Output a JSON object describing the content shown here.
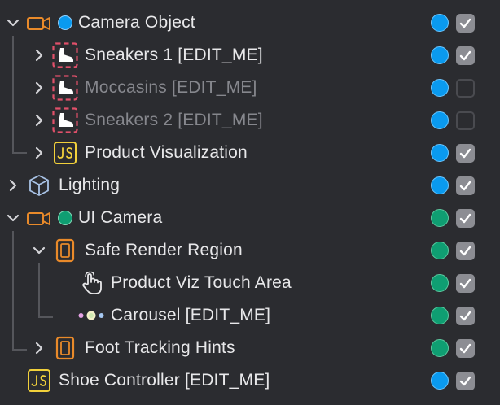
{
  "colors": {
    "blue": "#0a9aef",
    "green": "#0f9e72",
    "orange": "#e98a2a",
    "red_dashed": "#e0506a",
    "yellow": "#f2d13b",
    "checkbox_on": "#8c8d93"
  },
  "tree": [
    {
      "label": "Camera Object",
      "icon": "camera-icon",
      "expanded": true,
      "visible": true,
      "enabled": true,
      "layer_color": "blue"
    },
    {
      "label": "Sneakers 1 [EDIT_ME]",
      "icon": "shoe-icon",
      "expanded": false,
      "visible": true,
      "enabled": true,
      "layer_color": "blue"
    },
    {
      "label": "Moccasins [EDIT_ME]",
      "icon": "shoe-icon",
      "expanded": false,
      "visible": false,
      "enabled": false,
      "layer_color": "blue"
    },
    {
      "label": "Sneakers 2 [EDIT_ME]",
      "icon": "shoe-icon",
      "expanded": false,
      "visible": false,
      "enabled": false,
      "layer_color": "blue"
    },
    {
      "label": "Product Visualization",
      "icon": "script-icon",
      "expanded": false,
      "visible": true,
      "enabled": true,
      "layer_color": "blue"
    },
    {
      "label": "Lighting",
      "icon": "cube-icon",
      "expanded": false,
      "visible": true,
      "enabled": true,
      "layer_color": "blue"
    },
    {
      "label": "UI Camera",
      "icon": "camera-icon",
      "expanded": true,
      "visible": true,
      "enabled": true,
      "layer_color": "green"
    },
    {
      "label": "Safe Render Region",
      "icon": "phone-region-icon",
      "expanded": true,
      "visible": true,
      "enabled": true,
      "layer_color": "green"
    },
    {
      "label": "Product Viz Touch Area",
      "icon": "hand-touch-icon",
      "visible": true,
      "enabled": true,
      "layer_color": "green"
    },
    {
      "label": "Carousel [EDIT_ME]",
      "icon": "carousel-icon",
      "visible": true,
      "enabled": true,
      "layer_color": "green"
    },
    {
      "label": "Foot Tracking Hints",
      "icon": "phone-region-icon",
      "expanded": false,
      "visible": true,
      "enabled": true,
      "layer_color": "green"
    },
    {
      "label": "Shoe Controller [EDIT_ME]",
      "icon": "script-icon",
      "visible": true,
      "enabled": true,
      "layer_color": "blue"
    }
  ]
}
